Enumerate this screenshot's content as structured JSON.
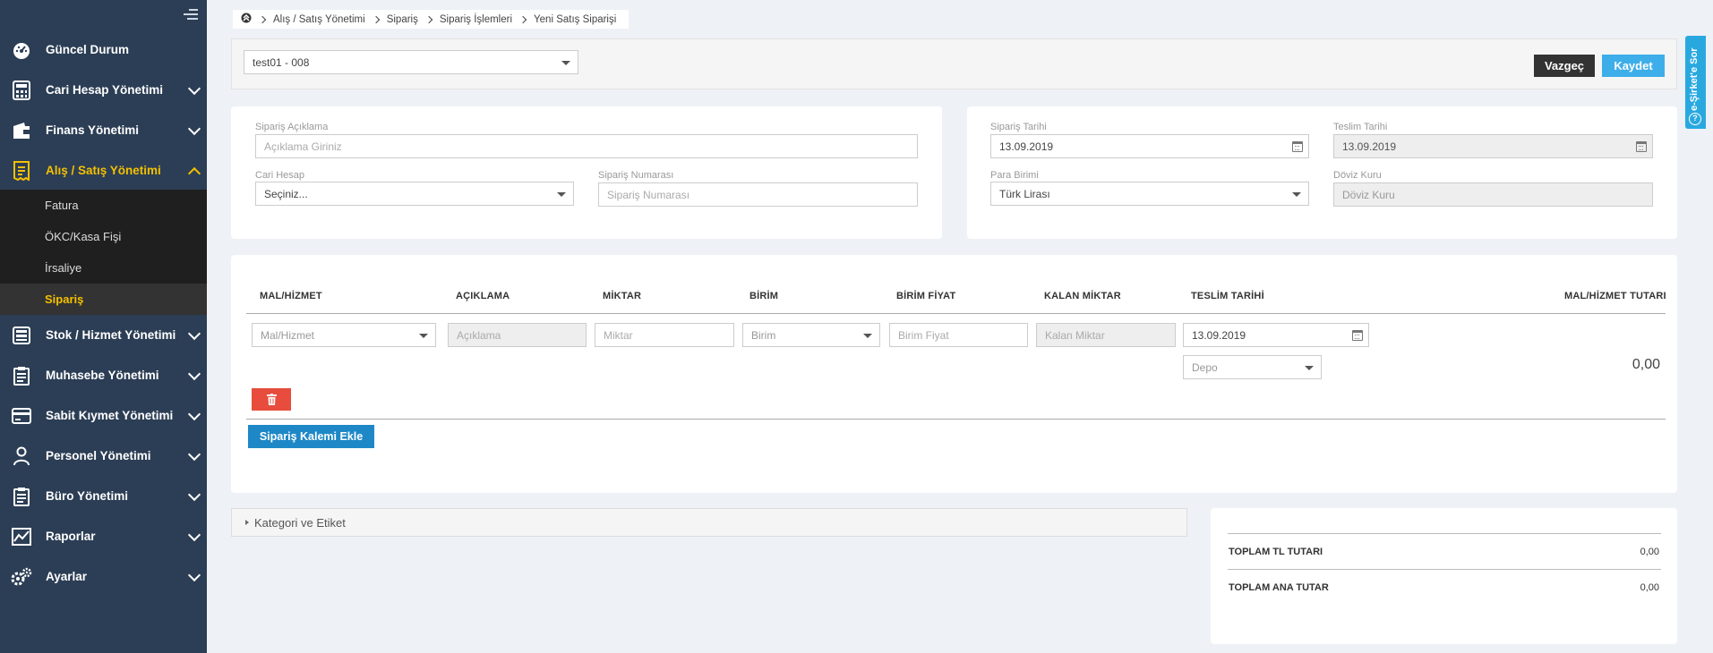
{
  "sidebar": {
    "items": [
      {
        "label": "Güncel Durum",
        "icon": "dashboard-icon"
      },
      {
        "label": "Cari Hesap Yönetimi",
        "icon": "calculator-icon"
      },
      {
        "label": "Finans Yönetimi",
        "icon": "wallet-icon"
      },
      {
        "label": "Alış / Satış Yönetimi",
        "icon": "receipt-icon"
      },
      {
        "label": "Stok / Hizmet Yönetimi",
        "icon": "stock-icon"
      },
      {
        "label": "Muhasebe Yönetimi",
        "icon": "clipboard-icon"
      },
      {
        "label": "Sabit Kıymet Yönetimi",
        "icon": "credit-card-icon"
      },
      {
        "label": "Personel Yönetimi",
        "icon": "person-icon"
      },
      {
        "label": "Büro Yönetimi",
        "icon": "clipboard-icon"
      },
      {
        "label": "Raporlar",
        "icon": "chart-icon"
      },
      {
        "label": "Ayarlar",
        "icon": "gears-icon"
      }
    ],
    "submenu": [
      "Fatura",
      "ÖKC/Kasa Fişi",
      "İrsaliye",
      "Sipariş"
    ],
    "active_color": "#f4c000"
  },
  "breadcrumb": [
    "Alış / Satış Yönetimi",
    "Sipariş",
    "Sipariş İşlemleri",
    "Yeni Satış Siparişi"
  ],
  "toolbar": {
    "company": "test01 - 008",
    "cancel_label": "Vazgeç",
    "save_label": "Kaydet"
  },
  "form": {
    "aciklama_label": "Sipariş Açıklama",
    "aciklama_placeholder": "Açıklama Giriniz",
    "cari_label": "Cari Hesap",
    "cari_value": "Seçiniz...",
    "siparis_no_label": "Sipariş Numarası",
    "siparis_no_placeholder": "Sipariş Numarası",
    "siparis_tarihi_label": "Sipariş Tarihi",
    "siparis_tarihi": "13.09.2019",
    "teslim_tarihi_label": "Teslim Tarihi",
    "teslim_tarihi": "13.09.2019",
    "para_birimi_label": "Para Birimi",
    "para_birimi": "Türk Lirası",
    "doviz_label": "Döviz Kuru",
    "doviz_placeholder": "Döviz Kuru"
  },
  "items_table": {
    "headers": [
      "MAL/HİZMET",
      "AÇIKLAMA",
      "MİKTAR",
      "BİRİM",
      "BİRİM FİYAT",
      "KALAN MİKTAR",
      "TESLİM TARİHİ",
      "MAL/HİZMET TUTARI"
    ],
    "row": {
      "mal_hizmet": "Mal/Hizmet",
      "aciklama": "Açıklama",
      "miktar": "Miktar",
      "birim": "Birim",
      "birim_fiyat": "Birim Fiyat",
      "kalan_miktar": "Kalan Miktar",
      "teslim_tarihi": "13.09.2019",
      "depo": "Depo",
      "tutar": "0,00"
    },
    "add_label": "Sipariş Kalemi Ekle"
  },
  "accordion": {
    "label": "Kategori ve Etiket"
  },
  "totals": [
    {
      "label": "TOPLAM TL TUTARI",
      "value": "0,00"
    },
    {
      "label": "TOPLAM ANA TUTAR",
      "value": "0,00"
    }
  ],
  "help_tab": {
    "label": "e-Şirket'e Sor"
  }
}
